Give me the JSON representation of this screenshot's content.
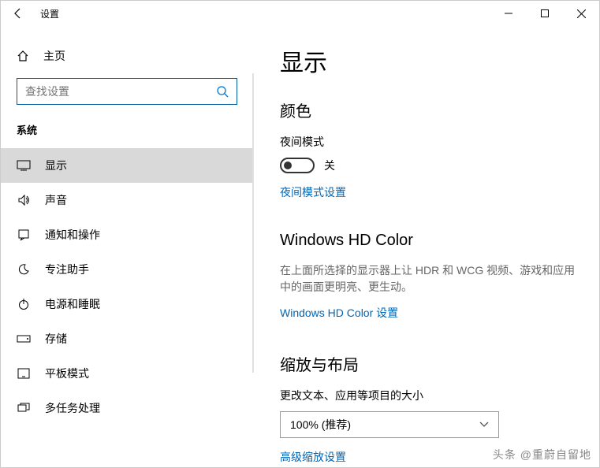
{
  "window": {
    "title": "设置"
  },
  "sidebar": {
    "home": "主页",
    "search_placeholder": "查找设置",
    "category": "系统",
    "items": [
      {
        "label": "显示",
        "active": true
      },
      {
        "label": "声音"
      },
      {
        "label": "通知和操作"
      },
      {
        "label": "专注助手"
      },
      {
        "label": "电源和睡眠"
      },
      {
        "label": "存储"
      },
      {
        "label": "平板模式"
      },
      {
        "label": "多任务处理"
      }
    ]
  },
  "main": {
    "title": "显示",
    "color_h": "颜色",
    "night_mode_label": "夜间模式",
    "night_mode_state": "关",
    "night_mode_link": "夜间模式设置",
    "hd_h": "Windows HD Color",
    "hd_desc": "在上面所选择的显示器上让 HDR 和 WCG 视频、游戏和应用中的画面更明亮、更生动。",
    "hd_link": "Windows HD Color 设置",
    "scale_h": "缩放与布局",
    "scale_label": "更改文本、应用等项目的大小",
    "scale_value": "100% (推荐)",
    "scale_link": "高级缩放设置"
  },
  "watermark": "头条 @重蔚自留地"
}
